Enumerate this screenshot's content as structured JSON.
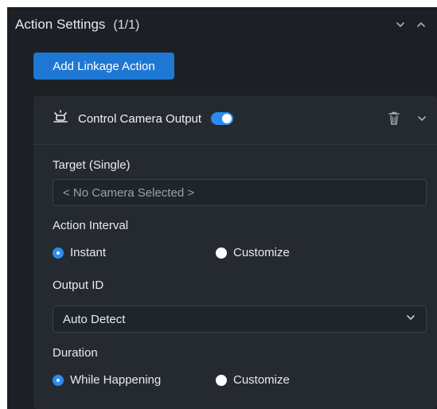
{
  "header": {
    "title": "Action Settings",
    "count": "(1/1)",
    "collapse_icon": "chevron-down-icon",
    "expand_icon": "chevron-up-icon"
  },
  "toolbar": {
    "add_label": "Add Linkage Action"
  },
  "card": {
    "icon": "camera-output-icon",
    "title": "Control Camera Output",
    "toggle_on": true,
    "delete_icon": "trash-icon",
    "expand_icon": "chevron-down-icon",
    "target": {
      "label": "Target (Single)",
      "placeholder": "< No Camera Selected >",
      "value": ""
    },
    "action_interval": {
      "label": "Action Interval",
      "options": [
        "Instant",
        "Customize"
      ],
      "selected": "Instant"
    },
    "output_id": {
      "label": "Output ID",
      "value": "Auto Detect"
    },
    "duration": {
      "label": "Duration",
      "options": [
        "While Happening",
        "Customize"
      ],
      "selected": "While Happening"
    }
  },
  "colors": {
    "accent": "#2a8cf0",
    "button": "#1e77d2",
    "panel": "#1c1f24",
    "card": "#252a31"
  }
}
